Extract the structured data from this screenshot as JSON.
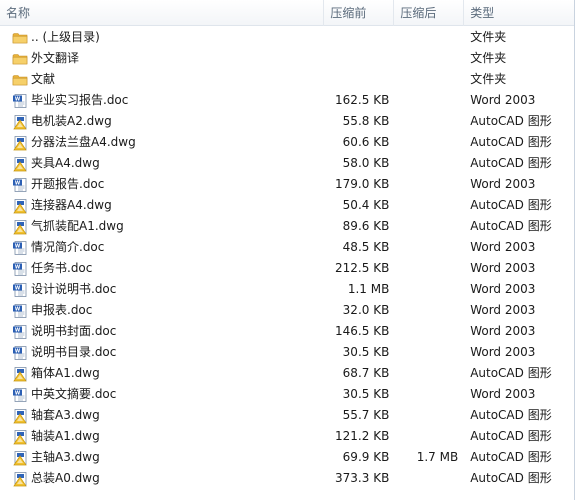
{
  "columns": {
    "name": "名称",
    "size": "压缩前",
    "after": "压缩后",
    "type": "类型"
  },
  "files": [
    {
      "name": ".. (上级目录)",
      "size": "",
      "after": "",
      "type": "文件夹",
      "icon": "folder-icon"
    },
    {
      "name": "外文翻译",
      "size": "",
      "after": "",
      "type": "文件夹",
      "icon": "folder-icon"
    },
    {
      "name": "文献",
      "size": "",
      "after": "",
      "type": "文件夹",
      "icon": "folder-icon"
    },
    {
      "name": "毕业实习报告.doc",
      "size": "162.5 KB",
      "after": "",
      "type": "Word 2003",
      "icon": "word-doc-icon"
    },
    {
      "name": "电机装A2.dwg",
      "size": "55.8 KB",
      "after": "",
      "type": "AutoCAD 图形",
      "icon": "autocad-dwg-icon"
    },
    {
      "name": "分器法兰盘A4.dwg",
      "size": "60.6 KB",
      "after": "",
      "type": "AutoCAD 图形",
      "icon": "autocad-dwg-icon"
    },
    {
      "name": "夹具A4.dwg",
      "size": "58.0 KB",
      "after": "",
      "type": "AutoCAD 图形",
      "icon": "autocad-dwg-icon"
    },
    {
      "name": "开题报告.doc",
      "size": "179.0 KB",
      "after": "",
      "type": "Word 2003",
      "icon": "word-doc-icon"
    },
    {
      "name": "连接器A4.dwg",
      "size": "50.4 KB",
      "after": "",
      "type": "AutoCAD 图形",
      "icon": "autocad-dwg-icon"
    },
    {
      "name": "气抓装配A1.dwg",
      "size": "89.6 KB",
      "after": "",
      "type": "AutoCAD 图形",
      "icon": "autocad-dwg-icon"
    },
    {
      "name": "情况简介.doc",
      "size": "48.5 KB",
      "after": "",
      "type": "Word 2003",
      "icon": "word-doc-icon"
    },
    {
      "name": "任务书.doc",
      "size": "212.5 KB",
      "after": "",
      "type": "Word 2003",
      "icon": "word-doc-icon"
    },
    {
      "name": "设计说明书.doc",
      "size": "1.1 MB",
      "after": "",
      "type": "Word 2003",
      "icon": "word-doc-icon"
    },
    {
      "name": "申报表.doc",
      "size": "32.0 KB",
      "after": "",
      "type": "Word 2003",
      "icon": "word-doc-icon"
    },
    {
      "name": "说明书封面.doc",
      "size": "146.5 KB",
      "after": "",
      "type": "Word 2003",
      "icon": "word-doc-icon"
    },
    {
      "name": "说明书目录.doc",
      "size": "30.5 KB",
      "after": "",
      "type": "Word 2003",
      "icon": "word-doc-icon"
    },
    {
      "name": "箱体A1.dwg",
      "size": "68.7 KB",
      "after": "",
      "type": "AutoCAD 图形",
      "icon": "autocad-dwg-icon"
    },
    {
      "name": "中英文摘要.doc",
      "size": "30.5 KB",
      "after": "",
      "type": "Word 2003",
      "icon": "word-doc-icon"
    },
    {
      "name": "轴套A3.dwg",
      "size": "55.7 KB",
      "after": "",
      "type": "AutoCAD 图形",
      "icon": "autocad-dwg-icon"
    },
    {
      "name": "轴装A1.dwg",
      "size": "121.2 KB",
      "after": "",
      "type": "AutoCAD 图形",
      "icon": "autocad-dwg-icon"
    },
    {
      "name": "主轴A3.dwg",
      "size": "69.9 KB",
      "after": "1.7 MB",
      "type": "AutoCAD 图形",
      "icon": "autocad-dwg-icon"
    },
    {
      "name": "总装A0.dwg",
      "size": "373.3 KB",
      "after": "",
      "type": "AutoCAD 图形",
      "icon": "autocad-dwg-icon"
    }
  ],
  "colors": {
    "header_text": "#5b6b7c",
    "folder": "#f3c24e",
    "word_blue": "#2b5fb4",
    "autocad_yellow": "#f2c230"
  }
}
